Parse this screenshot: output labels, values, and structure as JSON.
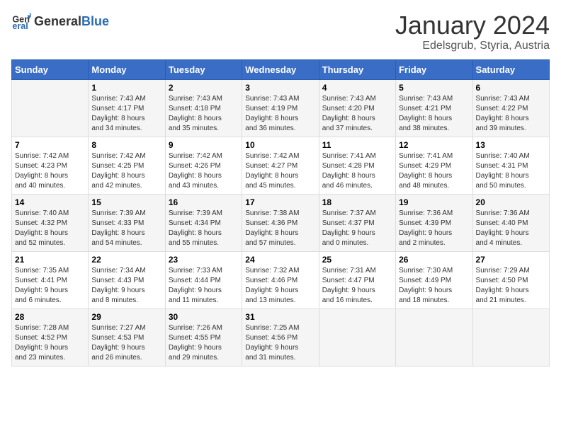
{
  "logo": {
    "text_general": "General",
    "text_blue": "Blue"
  },
  "title": "January 2024",
  "subtitle": "Edelsgrub, Styria, Austria",
  "columns": [
    "Sunday",
    "Monday",
    "Tuesday",
    "Wednesday",
    "Thursday",
    "Friday",
    "Saturday"
  ],
  "weeks": [
    [
      {
        "day": "",
        "content": ""
      },
      {
        "day": "1",
        "content": "Sunrise: 7:43 AM\nSunset: 4:17 PM\nDaylight: 8 hours\nand 34 minutes."
      },
      {
        "day": "2",
        "content": "Sunrise: 7:43 AM\nSunset: 4:18 PM\nDaylight: 8 hours\nand 35 minutes."
      },
      {
        "day": "3",
        "content": "Sunrise: 7:43 AM\nSunset: 4:19 PM\nDaylight: 8 hours\nand 36 minutes."
      },
      {
        "day": "4",
        "content": "Sunrise: 7:43 AM\nSunset: 4:20 PM\nDaylight: 8 hours\nand 37 minutes."
      },
      {
        "day": "5",
        "content": "Sunrise: 7:43 AM\nSunset: 4:21 PM\nDaylight: 8 hours\nand 38 minutes."
      },
      {
        "day": "6",
        "content": "Sunrise: 7:43 AM\nSunset: 4:22 PM\nDaylight: 8 hours\nand 39 minutes."
      }
    ],
    [
      {
        "day": "7",
        "content": "Sunrise: 7:42 AM\nSunset: 4:23 PM\nDaylight: 8 hours\nand 40 minutes."
      },
      {
        "day": "8",
        "content": "Sunrise: 7:42 AM\nSunset: 4:25 PM\nDaylight: 8 hours\nand 42 minutes."
      },
      {
        "day": "9",
        "content": "Sunrise: 7:42 AM\nSunset: 4:26 PM\nDaylight: 8 hours\nand 43 minutes."
      },
      {
        "day": "10",
        "content": "Sunrise: 7:42 AM\nSunset: 4:27 PM\nDaylight: 8 hours\nand 45 minutes."
      },
      {
        "day": "11",
        "content": "Sunrise: 7:41 AM\nSunset: 4:28 PM\nDaylight: 8 hours\nand 46 minutes."
      },
      {
        "day": "12",
        "content": "Sunrise: 7:41 AM\nSunset: 4:29 PM\nDaylight: 8 hours\nand 48 minutes."
      },
      {
        "day": "13",
        "content": "Sunrise: 7:40 AM\nSunset: 4:31 PM\nDaylight: 8 hours\nand 50 minutes."
      }
    ],
    [
      {
        "day": "14",
        "content": "Sunrise: 7:40 AM\nSunset: 4:32 PM\nDaylight: 8 hours\nand 52 minutes."
      },
      {
        "day": "15",
        "content": "Sunrise: 7:39 AM\nSunset: 4:33 PM\nDaylight: 8 hours\nand 54 minutes."
      },
      {
        "day": "16",
        "content": "Sunrise: 7:39 AM\nSunset: 4:34 PM\nDaylight: 8 hours\nand 55 minutes."
      },
      {
        "day": "17",
        "content": "Sunrise: 7:38 AM\nSunset: 4:36 PM\nDaylight: 8 hours\nand 57 minutes."
      },
      {
        "day": "18",
        "content": "Sunrise: 7:37 AM\nSunset: 4:37 PM\nDaylight: 9 hours\nand 0 minutes."
      },
      {
        "day": "19",
        "content": "Sunrise: 7:36 AM\nSunset: 4:39 PM\nDaylight: 9 hours\nand 2 minutes."
      },
      {
        "day": "20",
        "content": "Sunrise: 7:36 AM\nSunset: 4:40 PM\nDaylight: 9 hours\nand 4 minutes."
      }
    ],
    [
      {
        "day": "21",
        "content": "Sunrise: 7:35 AM\nSunset: 4:41 PM\nDaylight: 9 hours\nand 6 minutes."
      },
      {
        "day": "22",
        "content": "Sunrise: 7:34 AM\nSunset: 4:43 PM\nDaylight: 9 hours\nand 8 minutes."
      },
      {
        "day": "23",
        "content": "Sunrise: 7:33 AM\nSunset: 4:44 PM\nDaylight: 9 hours\nand 11 minutes."
      },
      {
        "day": "24",
        "content": "Sunrise: 7:32 AM\nSunset: 4:46 PM\nDaylight: 9 hours\nand 13 minutes."
      },
      {
        "day": "25",
        "content": "Sunrise: 7:31 AM\nSunset: 4:47 PM\nDaylight: 9 hours\nand 16 minutes."
      },
      {
        "day": "26",
        "content": "Sunrise: 7:30 AM\nSunset: 4:49 PM\nDaylight: 9 hours\nand 18 minutes."
      },
      {
        "day": "27",
        "content": "Sunrise: 7:29 AM\nSunset: 4:50 PM\nDaylight: 9 hours\nand 21 minutes."
      }
    ],
    [
      {
        "day": "28",
        "content": "Sunrise: 7:28 AM\nSunset: 4:52 PM\nDaylight: 9 hours\nand 23 minutes."
      },
      {
        "day": "29",
        "content": "Sunrise: 7:27 AM\nSunset: 4:53 PM\nDaylight: 9 hours\nand 26 minutes."
      },
      {
        "day": "30",
        "content": "Sunrise: 7:26 AM\nSunset: 4:55 PM\nDaylight: 9 hours\nand 29 minutes."
      },
      {
        "day": "31",
        "content": "Sunrise: 7:25 AM\nSunset: 4:56 PM\nDaylight: 9 hours\nand 31 minutes."
      },
      {
        "day": "",
        "content": ""
      },
      {
        "day": "",
        "content": ""
      },
      {
        "day": "",
        "content": ""
      }
    ]
  ]
}
